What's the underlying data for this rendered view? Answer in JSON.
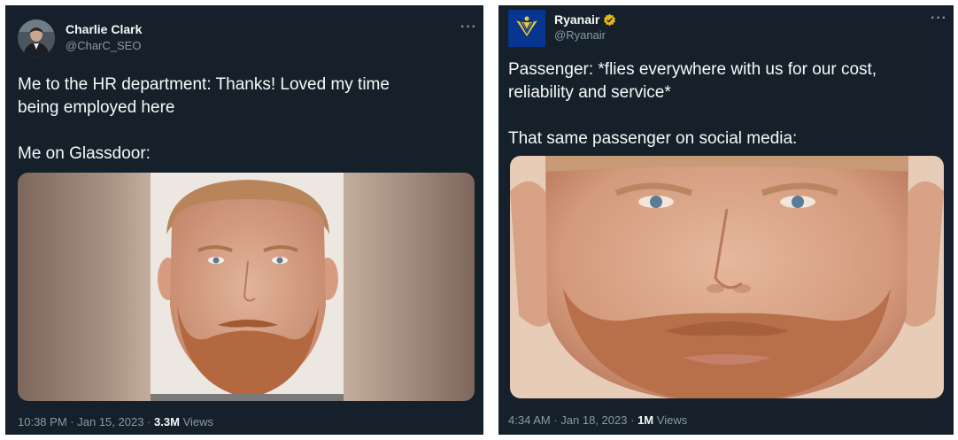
{
  "left_tweet": {
    "author_name": "Charlie Clark",
    "handle": "@CharC_SEO",
    "more_icon": "more-options-icon",
    "text_line1": "Me to the HR department: Thanks! Loved my time",
    "text_line2": "being employed here",
    "text_line3": "Me on Glassdoor:",
    "time": "10:38 PM",
    "date": "Jan 15, 2023",
    "views_count": "3.3M",
    "views_label": "Views",
    "separator": "·"
  },
  "right_tweet": {
    "author_name": "Ryanair",
    "verified_icon": "verified-badge-icon",
    "handle": "@Ryanair",
    "more_icon": "more-options-icon",
    "text_line1": "Passenger: *flies everywhere with us for our cost,",
    "text_line2": "reliability and service*",
    "text_line3": "That same passenger on social media:",
    "time": "4:34 AM",
    "date": "Jan 18, 2023",
    "views_count": "1M",
    "views_label": "Views",
    "separator": "·"
  },
  "colors": {
    "tweet_background": "#15202b",
    "primary_text": "#f7f9f9",
    "secondary_text": "#8b98a5",
    "verified_gold": "#e2b719",
    "ryanair_blue": "#073590",
    "ryanair_yellow": "#f1c933"
  }
}
